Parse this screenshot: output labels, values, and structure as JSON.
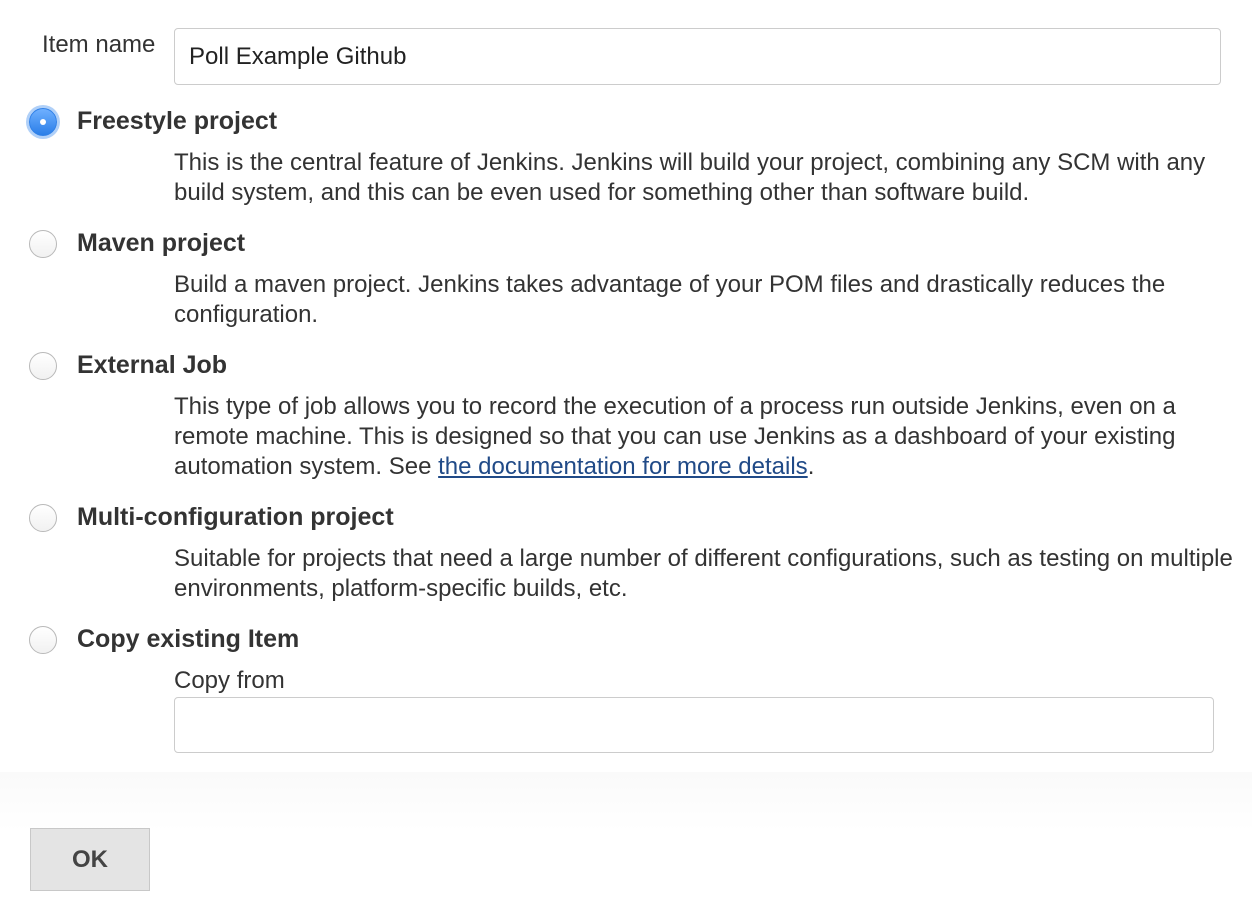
{
  "item_name": {
    "label": "Item name",
    "value": "Poll Example Github"
  },
  "options": [
    {
      "title": "Freestyle project",
      "selected": true,
      "description": "This is the central feature of Jenkins. Jenkins will build your project, combining any SCM with any build system, and this can be even used for something other than software build."
    },
    {
      "title": "Maven project",
      "selected": false,
      "description": "Build a maven project. Jenkins takes advantage of your POM files and drastically reduces the configuration."
    },
    {
      "title": "External Job",
      "selected": false,
      "description": "This type of job allows you to record the execution of a process run outside Jenkins, even on a remote machine. This is designed so that you can use Jenkins as a dashboard of your existing automation system. See",
      "link_text": "the documentation for more details",
      "after_link": "."
    },
    {
      "title": "Multi-configuration project",
      "selected": false,
      "description": "Suitable for projects that need a large number of different configurations, such as testing on multiple environments, platform-specific builds, etc."
    },
    {
      "title": "Copy existing Item",
      "selected": false
    }
  ],
  "copy_from": {
    "label": "Copy from",
    "value": ""
  },
  "ok_button": {
    "label": "OK"
  },
  "colors": {
    "selected_radio": "#2a7ee8",
    "link": "#204a87",
    "button_bg": "#e4e4e4"
  }
}
